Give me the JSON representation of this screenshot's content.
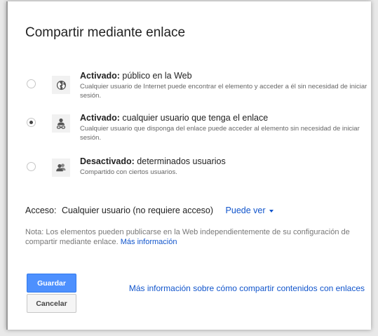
{
  "dialog": {
    "title": "Compartir mediante enlace"
  },
  "options": [
    {
      "head_bold": "Activado:",
      "head_rest": " público en la Web",
      "description": "Cualquier usuario de Internet puede encontrar el elemento y acceder a él sin necesidad de iniciar sesión.",
      "selected": false,
      "icon": "globe-icon"
    },
    {
      "head_bold": "Activado:",
      "head_rest": " cualquier usuario que tenga el enlace",
      "description": "Cualquier usuario que disponga del enlace puede acceder al elemento sin necesidad de iniciar sesión.",
      "selected": true,
      "icon": "person-link-icon"
    },
    {
      "head_bold": "Desactivado:",
      "head_rest": " determinados usuarios",
      "description": "Compartido con ciertos usuarios.",
      "selected": false,
      "icon": "people-icon"
    }
  ],
  "access": {
    "label": "Acceso:",
    "value": "Cualquier usuario (no requiere acceso)",
    "permission": "Puede ver"
  },
  "note": {
    "text": "Nota: Los elementos pueden publicarse en la Web independientemente de su configuración de compartir mediante enlace.",
    "link": "Más información"
  },
  "buttons": {
    "save": "Guardar",
    "cancel": "Cancelar"
  },
  "more_link": "Más información sobre cómo compartir contenidos con enlaces",
  "colors": {
    "link": "#1155cc",
    "primary_button": "#4d90fe",
    "dialog_bg": "#ffffff"
  }
}
